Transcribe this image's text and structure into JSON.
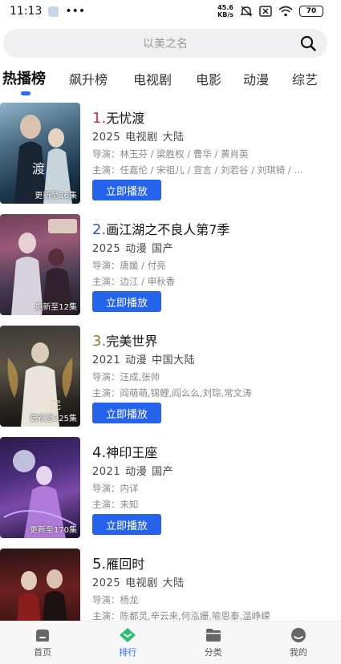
{
  "status_bar": {
    "time": "11:13",
    "dots": "•••",
    "net_speed": "45.6",
    "net_unit": "KB/s",
    "battery": "70"
  },
  "search": {
    "placeholder": "以美之名"
  },
  "tabs": [
    {
      "label": "热播榜",
      "active": true
    },
    {
      "label": "飙升榜"
    },
    {
      "label": "电视剧"
    },
    {
      "label": "电影"
    },
    {
      "label": "动漫"
    },
    {
      "label": "综艺"
    }
  ],
  "items": [
    {
      "rank": "1.",
      "title": "无忧渡",
      "year": "2025",
      "type": "电视剧",
      "region": "大陆",
      "director": "导演：林玉芬 / 梁胜权 / 曹华 / 黄肖英",
      "cast": "主演：任嘉伦 / 宋祖儿 / 宣言 / 刘若谷 / 刘琪锜 / ...",
      "badge": "更新至36集",
      "rank_color": "#c0374a"
    },
    {
      "rank": "2.",
      "title": "画江湖之不良人第7季",
      "year": "2025",
      "type": "动漫",
      "region": "国产",
      "director": "导演：唐媛 / 付亮",
      "cast": "主演：边江 / 申秋香",
      "badge": "更新至12集",
      "rank_color": "#3a55a8"
    },
    {
      "rank": "3.",
      "title": "完美世界",
      "year": "2021",
      "type": "动漫",
      "region": "中国大陆",
      "director": "导演：汪成,张帅",
      "cast": "主演：阎萌萌,锦鲤,阎么么,刘琮,常文涛",
      "badge": "更新至225集",
      "rank_color": "#9a7a3a"
    },
    {
      "rank": "4.",
      "title": "神印王座",
      "year": "2021",
      "type": "动漫",
      "region": "国产",
      "director": "导演：内详",
      "cast": "主演：未知",
      "badge": "更新至170集",
      "rank_color": "#222222"
    },
    {
      "rank": "5.",
      "title": "雁回时",
      "year": "2025",
      "type": "电视剧",
      "region": "大陆",
      "director": "导演：杨龙",
      "cast": "主演：陈都灵,辛云来,何泓姗,喻恩泰,温峥嵘",
      "badge": "",
      "rank_color": "#222222"
    }
  ],
  "play_label": "立即播放",
  "bottom_nav": [
    {
      "label": "首页",
      "icon": "home-icon"
    },
    {
      "label": "排行",
      "icon": "rank-icon",
      "active": true
    },
    {
      "label": "分类",
      "icon": "folder-icon"
    },
    {
      "label": "我的",
      "icon": "profile-icon"
    }
  ],
  "colors": {
    "accent": "#2a6bf0",
    "button": "#2563eb",
    "nav_active": "#2a6bf0"
  }
}
